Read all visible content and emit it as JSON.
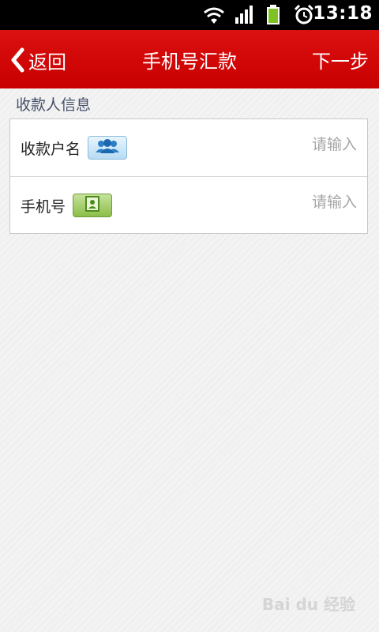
{
  "status_bar": {
    "time": "13:18",
    "icons": [
      "wifi-icon",
      "signal-icon",
      "battery-icon",
      "alarm-icon"
    ]
  },
  "header": {
    "back_label": "返回",
    "title": "手机号汇款",
    "next_label": "下一步",
    "color": "#d50a0a"
  },
  "section": {
    "title": "收款人信息"
  },
  "form": {
    "rows": [
      {
        "label": "收款户名",
        "icon": "contacts-icon",
        "placeholder": "请输入"
      },
      {
        "label": "手机号",
        "icon": "address-book-icon",
        "placeholder": "请输入"
      }
    ]
  },
  "watermark": "Bai du 经验"
}
